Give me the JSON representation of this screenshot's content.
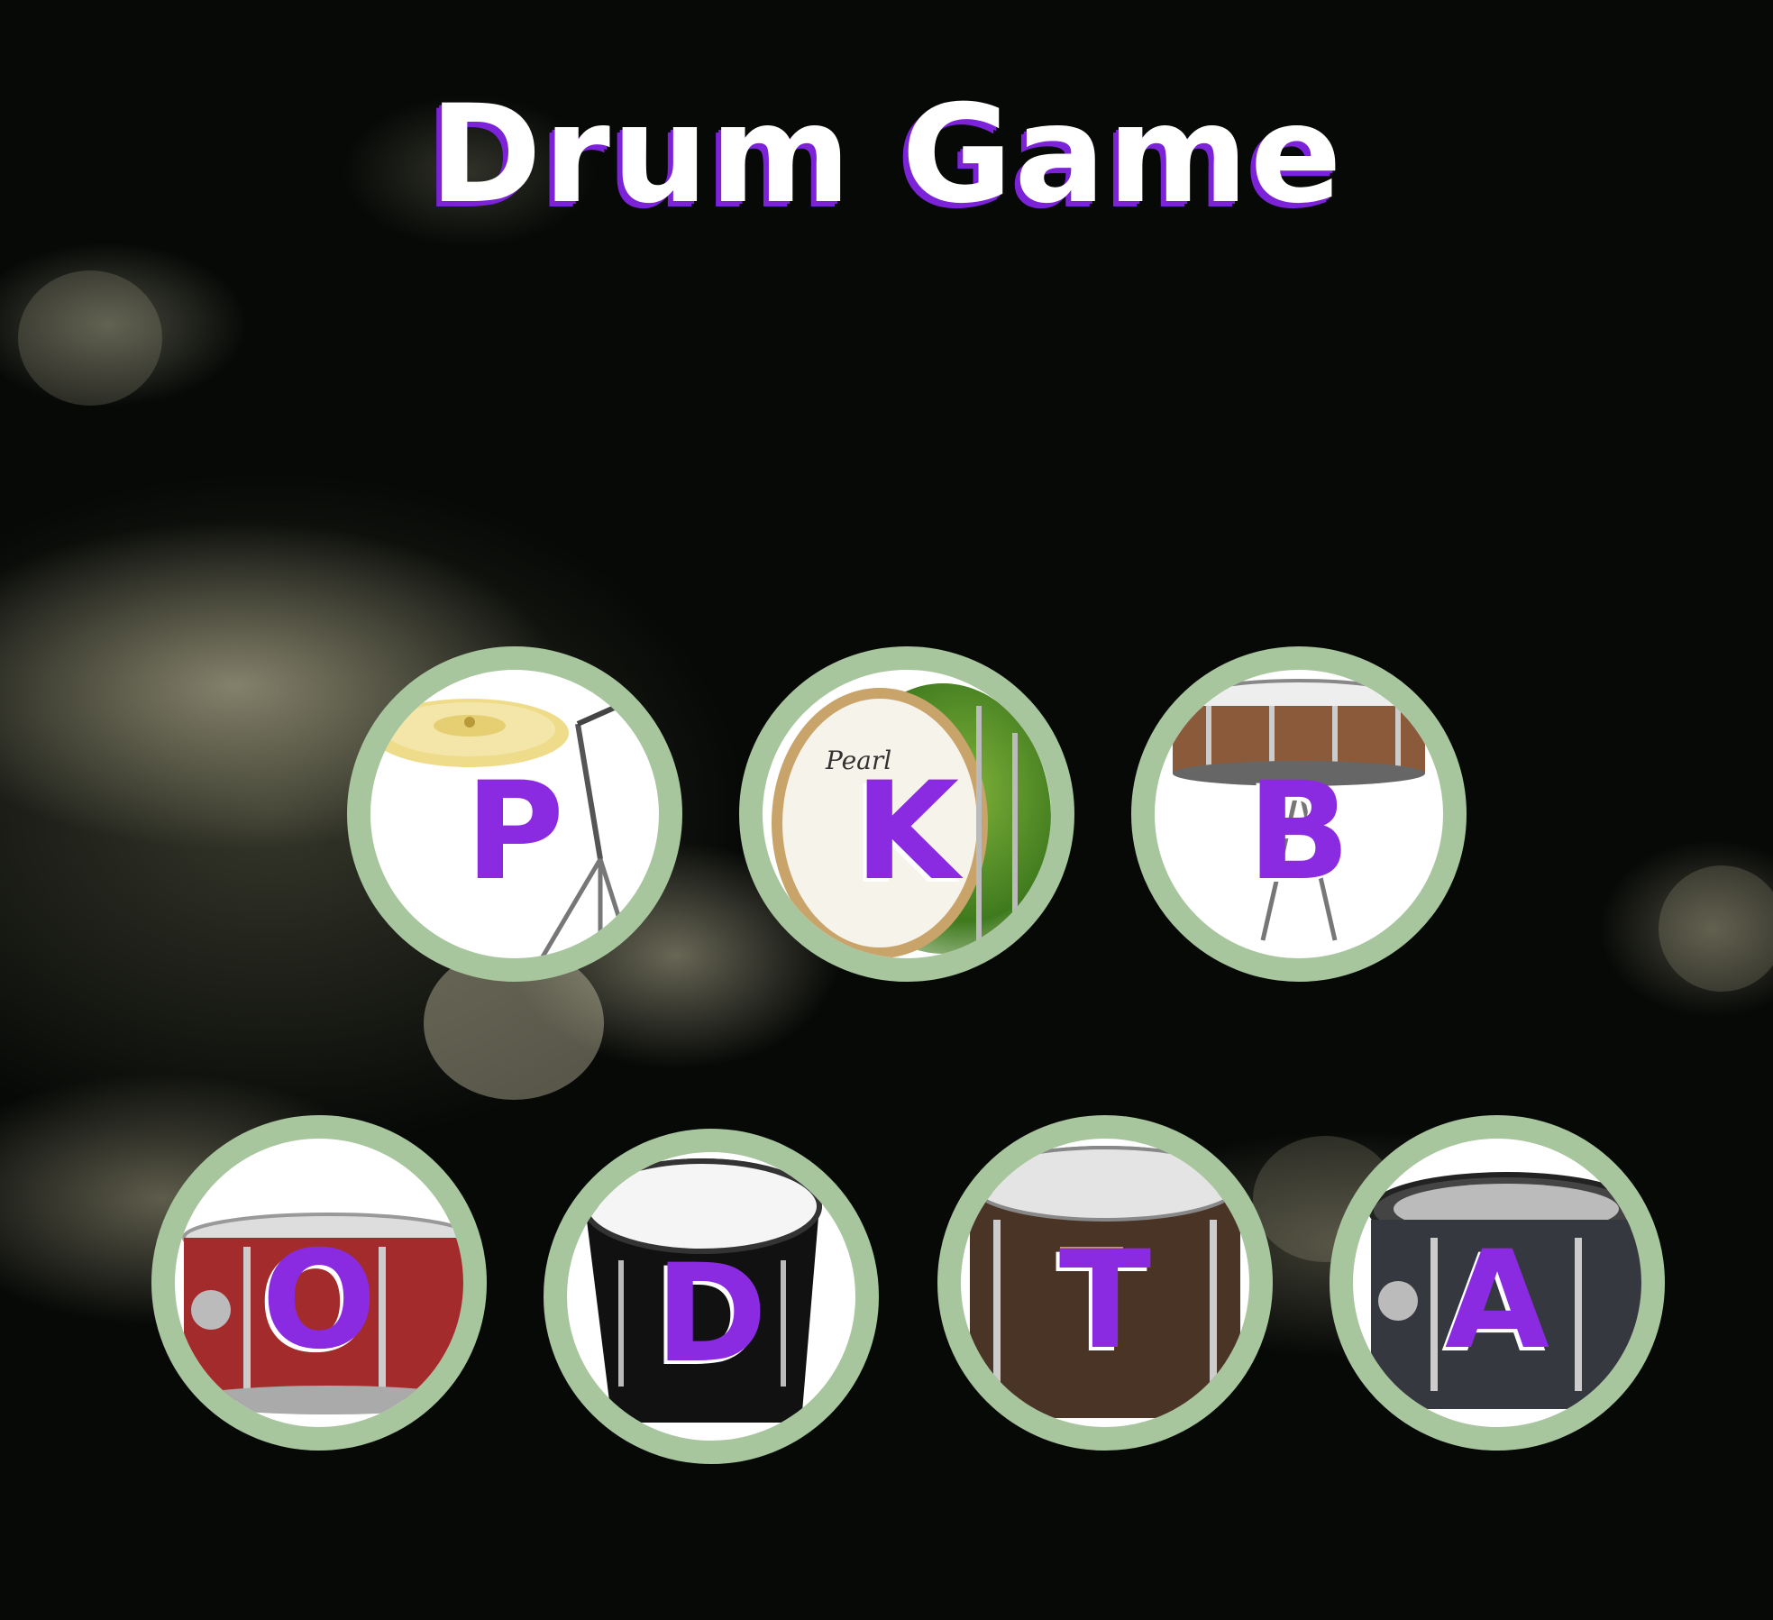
{
  "title": "Drum Game",
  "colors": {
    "accent": "#8a2be2",
    "pad_border": "#a8c69e",
    "title_shadow": "#7c22d8"
  },
  "pads": [
    {
      "key": "P",
      "instrument": "cymbal-icon"
    },
    {
      "key": "K",
      "instrument": "bass-drum-icon"
    },
    {
      "key": "B",
      "instrument": "snare-drum-icon"
    },
    {
      "key": "O",
      "instrument": "red-tom-icon"
    },
    {
      "key": "D",
      "instrument": "floor-tom-icon"
    },
    {
      "key": "T",
      "instrument": "brown-tom-icon"
    },
    {
      "key": "A",
      "instrument": "black-tom-icon"
    }
  ]
}
